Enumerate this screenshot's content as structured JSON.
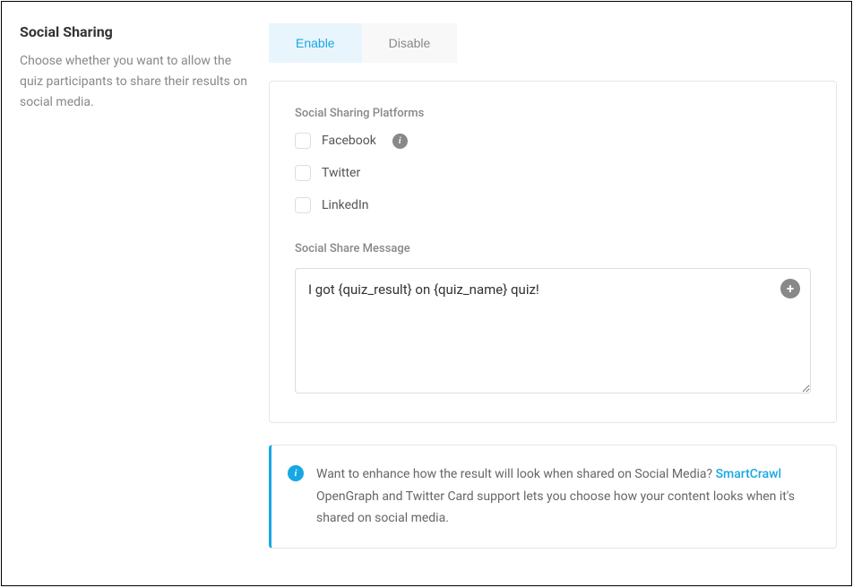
{
  "sidebar": {
    "title": "Social Sharing",
    "description": "Choose whether you want to allow the quiz participants to share their results on social media."
  },
  "tabs": {
    "enable": "Enable",
    "disable": "Disable"
  },
  "platforms": {
    "label": "Social Sharing Platforms",
    "facebook": "Facebook",
    "twitter": "Twitter",
    "linkedin": "LinkedIn"
  },
  "message": {
    "label": "Social Share Message",
    "value": "I got {quiz_result} on {quiz_name} quiz!"
  },
  "infobox": {
    "pre": "Want to enhance how the result will look when shared on Social Media? ",
    "link": "SmartCrawl",
    "post": " OpenGraph and Twitter Card support lets you choose how your content looks when it's shared on social media."
  }
}
